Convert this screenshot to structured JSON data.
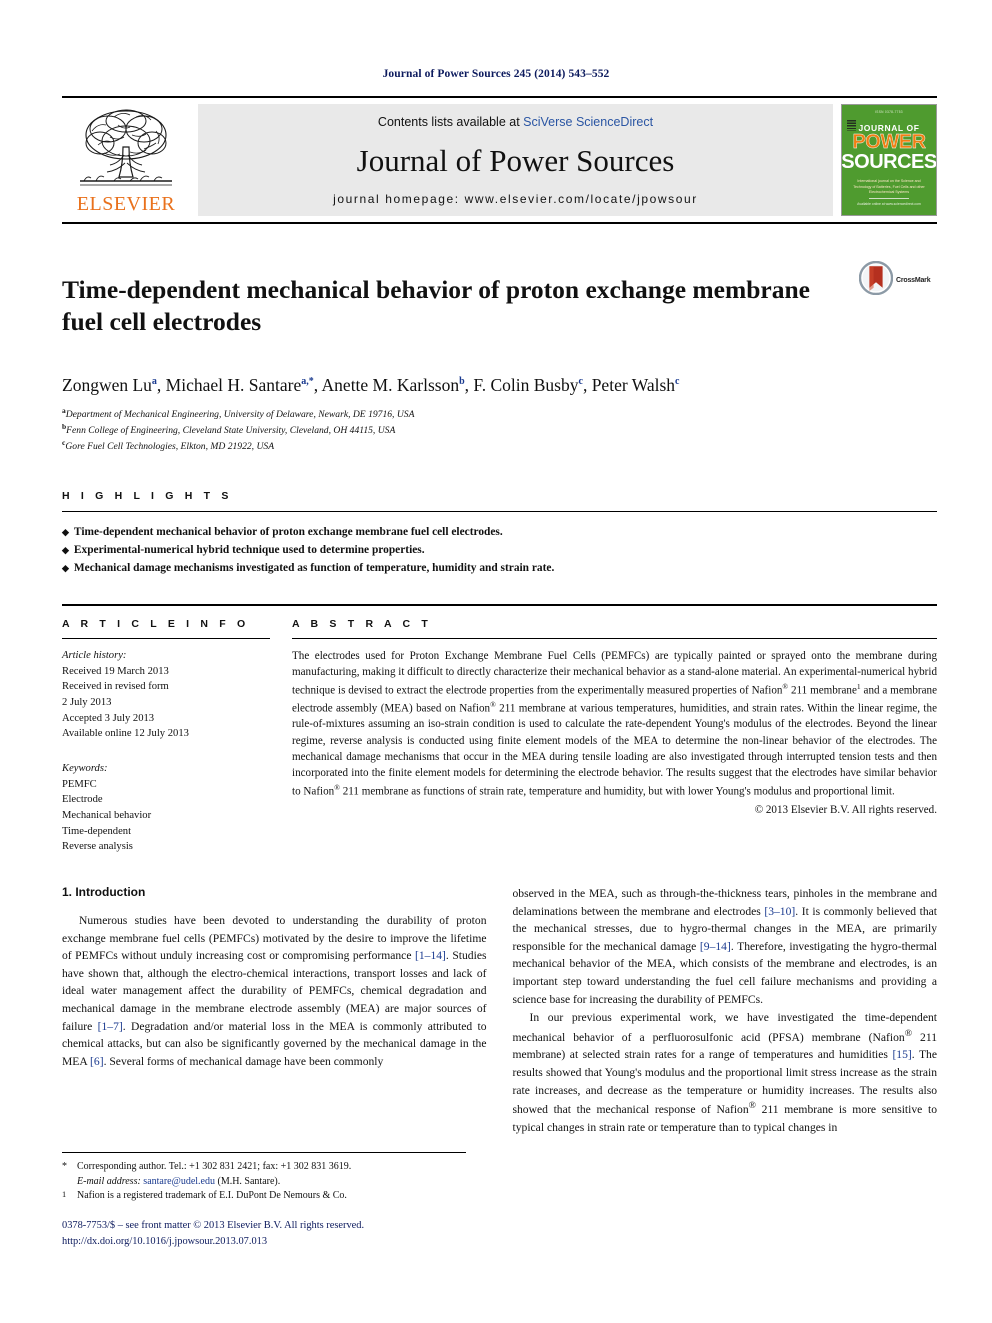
{
  "running_head": "Journal of Power Sources 245 (2014) 543–552",
  "masthead": {
    "publisher": "ELSEVIER",
    "contents_prefix": "Contents lists available at ",
    "contents_link": "SciVerse ScienceDirect",
    "journal_name": "Journal of Power Sources",
    "homepage": "journal homepage: www.elsevier.com/locate/jpowsour",
    "cover": {
      "top_label": "ISSN 0378-7753",
      "journal_of": "JOURNAL OF",
      "power": "POWER",
      "sources": "SOURCES",
      "blurb": "International journal on the Science and Technology of Batteries, Fuel Cells and other Electrochemical Systems",
      "foot": "Available online at www.sciencedirect.com"
    }
  },
  "article": {
    "title": "Time-dependent mechanical behavior of proton exchange membrane fuel cell electrodes",
    "crossmark_label": "CrossMark",
    "authors_html": "Zongwen Lu<sup>a</sup>, Michael H. Santare<sup>a,*</sup>, Anette M. Karlsson<sup>b</sup>, F. Colin Busby<sup>c</sup>, Peter Walsh<sup>c</sup>",
    "affiliations": [
      {
        "mark": "a",
        "text": "Department of Mechanical Engineering, University of Delaware, Newark, DE 19716, USA"
      },
      {
        "mark": "b",
        "text": "Fenn College of Engineering, Cleveland State University, Cleveland, OH 44115, USA"
      },
      {
        "mark": "c",
        "text": "Gore Fuel Cell Technologies, Elkton, MD 21922, USA"
      }
    ]
  },
  "highlights": {
    "heading": "H I G H L I G H T S",
    "items": [
      "Time-dependent mechanical behavior of proton exchange membrane fuel cell electrodes.",
      "Experimental-numerical hybrid technique used to determine properties.",
      "Mechanical damage mechanisms investigated as function of temperature, humidity and strain rate."
    ]
  },
  "article_info": {
    "heading": "A R T I C L E   I N F O",
    "history_label": "Article history:",
    "history": [
      "Received 19 March 2013",
      "Received in revised form",
      "2 July 2013",
      "Accepted 3 July 2013",
      "Available online 12 July 2013"
    ],
    "keywords_label": "Keywords:",
    "keywords": [
      "PEMFC",
      "Electrode",
      "Mechanical behavior",
      "Time-dependent",
      "Reverse analysis"
    ]
  },
  "abstract": {
    "heading": "A B S T R A C T",
    "text_html": "The electrodes used for Proton Exchange Membrane Fuel Cells (PEMFCs) are typically painted or sprayed onto the membrane during manufacturing, making it difficult to directly characterize their mechanical behavior as a stand-alone material. An experimental-numerical hybrid technique is devised to extract the electrode properties from the experimentally measured properties of Nafion<sup>®</sup> 211 membrane<sup>1</sup> and a membrane electrode assembly (MEA) based on Nafion<sup>®</sup> 211 membrane at various temperatures, humidities, and strain rates. Within the linear regime, the rule-of-mixtures assuming an iso-strain condition is used to calculate the rate-dependent Young's modulus of the electrodes. Beyond the linear regime, reverse analysis is conducted using finite element models of the MEA to determine the non-linear behavior of the electrodes. The mechanical damage mechanisms that occur in the MEA during tensile loading are also investigated through interrupted tension tests and then incorporated into the finite element models for determining the electrode behavior. The results suggest that the electrodes have similar behavior to Nafion<sup>®</sup> 211 membrane as functions of strain rate, temperature and humidity, but with lower Young's modulus and proportional limit.",
    "copyright": "© 2013 Elsevier B.V. All rights reserved."
  },
  "body": {
    "section_number_title": "1.  Introduction",
    "left_paragraph_html": "Numerous studies have been devoted to understanding the durability of proton exchange membrane fuel cells (PEMFCs) motivated by the desire to improve the lifetime of PEMFCs without unduly increasing cost or compromising performance <span class=\"cit\">[1–14]</span>. Studies have shown that, although the electro-chemical interactions, transport losses and lack of ideal water management affect the durability of PEMFCs, chemical degradation and mechanical damage in the membrane electrode assembly (MEA) are major sources of failure <span class=\"cit\">[1–7]</span>. Degradation and/or material loss in the MEA is commonly attributed to chemical attacks, but can also be significantly governed by the mechanical damage in the MEA <span class=\"cit\">[6]</span>. Several forms of mechanical damage have been commonly",
    "right_paragraph_1_html": "observed in the MEA, such as through-the-thickness tears, pinholes in the membrane and delaminations between the membrane and electrodes <span class=\"cit\">[3–10]</span>. It is commonly believed that the mechanical stresses, due to hygro-thermal changes in the MEA, are primarily responsible for the mechanical damage <span class=\"cit\">[9–14]</span>. Therefore, investigating the hygro-thermal mechanical behavior of the MEA, which consists of the membrane and electrodes, is an important step toward understanding the fuel cell failure mechanisms and providing a science base for increasing the durability of PEMFCs.",
    "right_paragraph_2_html": "In our previous experimental work, we have investigated the time-dependent mechanical behavior of a perfluorosulfonic acid (PFSA) membrane (Nafion<sup>®</sup> 211 membrane) at selected strain rates for a range of temperatures and humidities <span class=\"cit\">[15]</span>. The results showed that Young's modulus and the proportional limit stress increase as the strain rate increases, and decrease as the temperature or humidity increases. The results also showed that the mechanical response of Nafion<sup>®</sup> 211 membrane is more sensitive to typical changes in strain rate or temperature than to typical changes in"
  },
  "footnotes": [
    {
      "mark": "*",
      "html": "Corresponding author. Tel.: +1 302 831 2421; fax: +1 302 831 3619.<br><span class=\"it\">E-mail address:</span> <span class=\"link\">santare@udel.edu</span> (M.H. Santare)."
    },
    {
      "mark": "1",
      "html": "Nafion is a registered trademark of E.I. DuPont De Nemours &amp; Co."
    }
  ],
  "imprint": {
    "line1": "0378-7753/$ – see front matter © 2013 Elsevier B.V. All rights reserved.",
    "doi": "http://dx.doi.org/10.1016/j.jpowsour.2013.07.013"
  }
}
